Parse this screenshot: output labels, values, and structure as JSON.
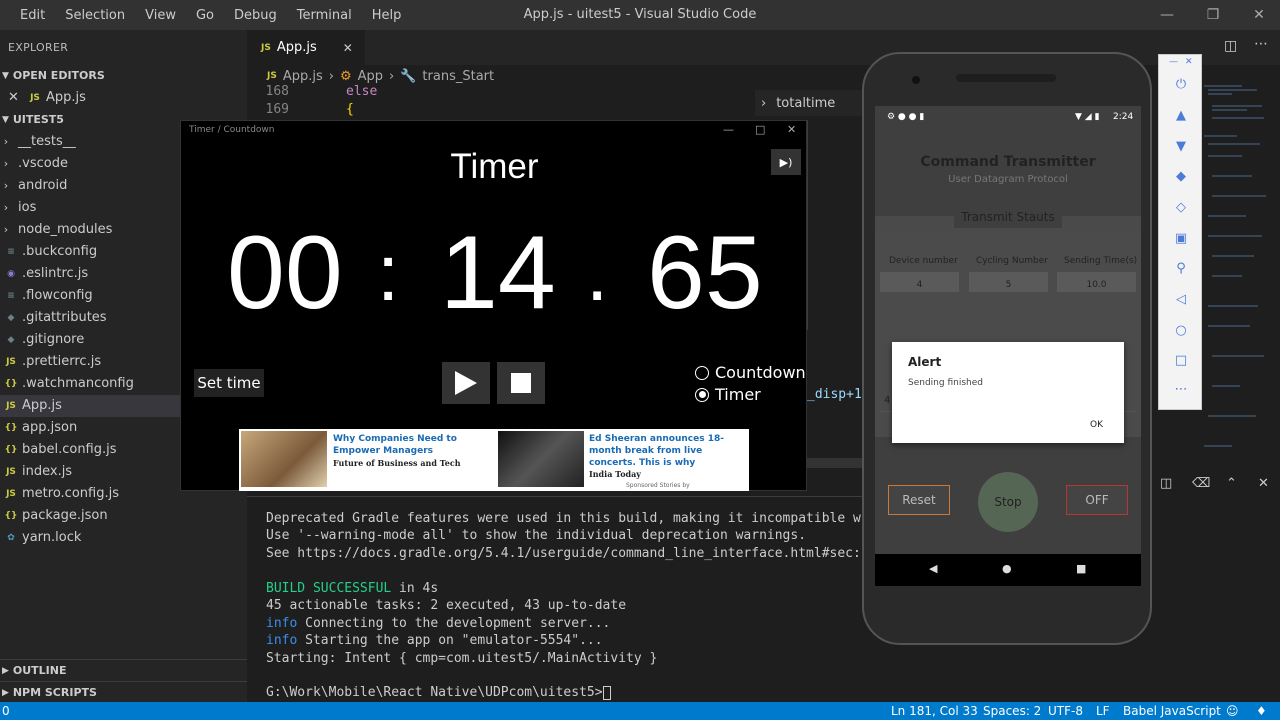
{
  "window": {
    "title": "App.js - uitest5 - Visual Studio Code"
  },
  "menu": {
    "items": [
      "Edit",
      "Selection",
      "View",
      "Go",
      "Debug",
      "Terminal",
      "Help"
    ]
  },
  "sidebar": {
    "header": "EXPLORER",
    "open_editors_label": "OPEN EDITORS",
    "open_editor_file": "App.js",
    "project_label": "UITEST5",
    "files": [
      "__tests__",
      ".vscode",
      "android",
      "ios",
      "node_modules",
      ".buckconfig",
      ".eslintrc.js",
      ".flowconfig",
      ".gitattributes",
      ".gitignore",
      ".prettierrc.js",
      ".watchmanconfig",
      "App.js",
      "app.json",
      "babel.config.js",
      "index.js",
      "metro.config.js",
      "package.json",
      "yarn.lock"
    ],
    "outline_label": "OUTLINE",
    "npm_label": "NPM SCRIPTS"
  },
  "editor": {
    "tab": "App.js",
    "tab_icon": "JS",
    "breadcrumb": [
      "App.js",
      "App",
      "trans_Start"
    ],
    "lines": [
      {
        "num": "168",
        "text": "else"
      },
      {
        "num": "169",
        "text": "{"
      }
    ],
    "outline_search": "totaltime",
    "partial_code": "_disp+1"
  },
  "terminal": {
    "lines": [
      "Deprecated Gradle features were used in this build, making it incompatible wit",
      "Use '--warning-mode all' to show the individual deprecation warnings.",
      "See https://docs.gradle.org/5.4.1/userguide/command_line_interface.html#sec:co",
      "",
      "BUILD SUCCESSFUL in 4s",
      "45 actionable tasks: 2 executed, 43 up-to-date",
      "info Connecting to the development server...",
      "info Starting the app on \"emulator-5554\"...",
      "Starting: Intent { cmp=com.uitest5/.MainActivity }",
      "",
      "G:\\Work\\Mobile\\React Native\\UDPcom\\uitest5>"
    ],
    "build_word": "BUILD SUCCESSFUL",
    "build_rest": " in 4s",
    "info_word": "info"
  },
  "status": {
    "left": "0",
    "position": "Ln 181, Col 33",
    "spaces": "Spaces: 2",
    "encoding": "UTF-8",
    "eol": "LF",
    "language": "Babel JavaScript"
  },
  "timer_app": {
    "window_title": "Timer / Countdown",
    "heading": "Timer",
    "minutes": "00",
    "sep1": ":",
    "seconds": "14",
    "sep2": ".",
    "hundredths": "65",
    "set_time": "Set time",
    "modes": [
      {
        "label": "Countdown",
        "selected": false
      },
      {
        "label": "Timer",
        "selected": true
      }
    ],
    "ad1_title": "Why Companies Need to Empower Managers",
    "ad1_source": "Future of Business and Tech",
    "ad2_title": "Ed Sheeran announces 18-month break from live concerts. This is why",
    "ad2_source": "India Today",
    "sponsored": "Sponsored Stories by"
  },
  "phone": {
    "time": "2:24",
    "app_title": "Command Transmitter",
    "app_subtitle": "User Datagram Protocol",
    "transmit_status": "Transmit Stauts",
    "col1": "Device number",
    "col2": "Cycling Number",
    "col3": "Sending Time(s)",
    "val1": "4",
    "val2": "5",
    "val3": "10.0",
    "sel1": "4",
    "sel2": "5",
    "sel3": "10",
    "reset": "Reset",
    "stop": "Stop",
    "off": "OFF",
    "alert_title": "Alert",
    "alert_message": "Sending finished",
    "alert_ok": "OK"
  },
  "colors": {
    "status_bar": "#007acc",
    "accent_orange": "#c87a3a",
    "link_blue": "#1a6bb4"
  }
}
